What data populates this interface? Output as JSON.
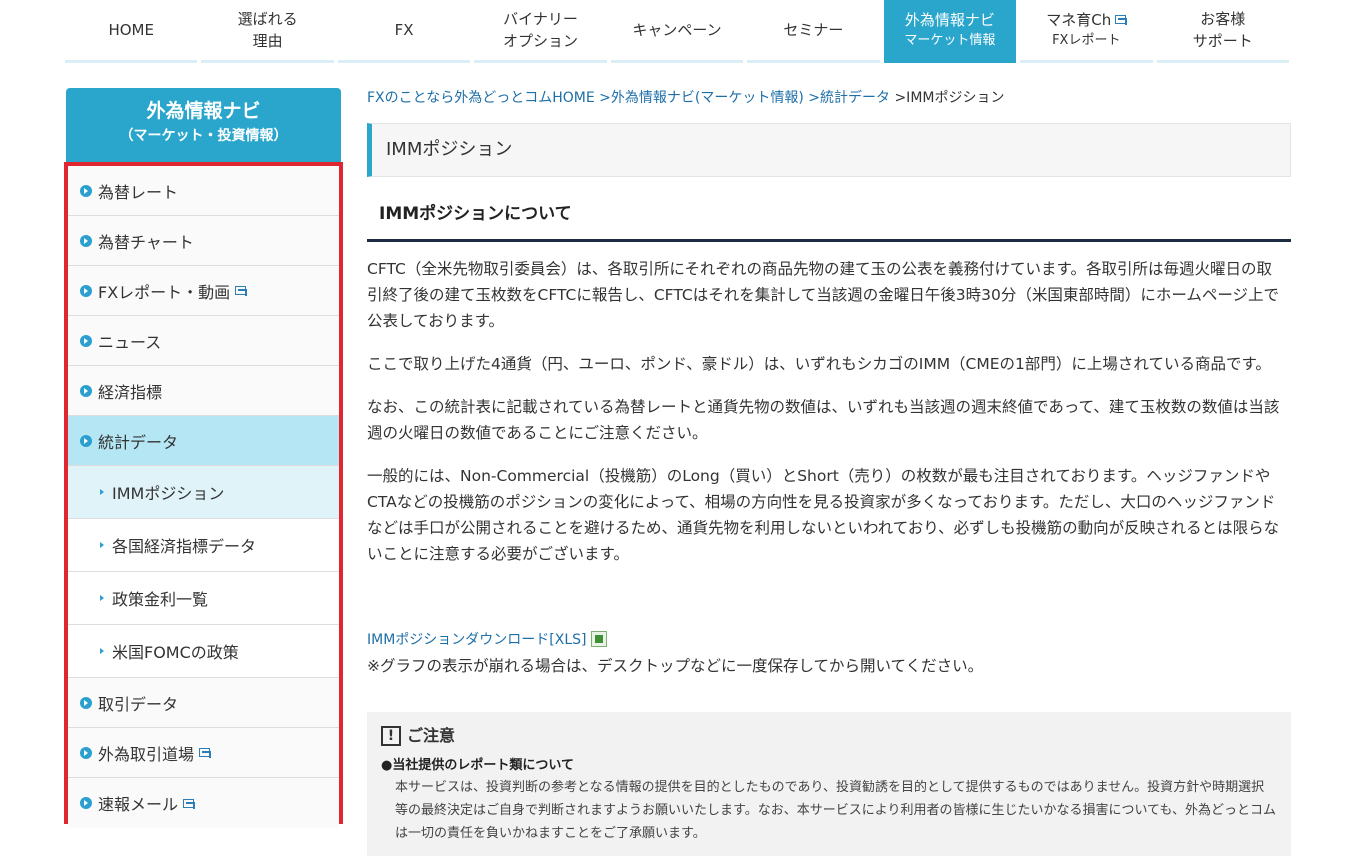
{
  "nav": {
    "items": [
      {
        "label": "HOME",
        "sub": ""
      },
      {
        "label": "選ばれる",
        "sub": "理由"
      },
      {
        "label": "FX",
        "sub": ""
      },
      {
        "label": "バイナリー",
        "sub": "オプション"
      },
      {
        "label": "キャンペーン",
        "sub": ""
      },
      {
        "label": "セミナー",
        "sub": ""
      },
      {
        "label": "外為情報ナビ",
        "sub": "マーケット情報"
      },
      {
        "label": "マネ育Ch",
        "sub": "FXレポート"
      },
      {
        "label": "お客様",
        "sub": "サポート"
      }
    ]
  },
  "sidebar": {
    "title": "外為情報ナビ",
    "subtitle": "（マーケット・投資情報）",
    "items": [
      "為替レート",
      "為替チャート",
      "FXレポート・動画",
      "ニュース",
      "経済指標",
      "統計データ",
      "IMMポジション",
      "各国経済指標データ",
      "政策金利一覧",
      "米国FOMCの政策",
      "取引データ",
      "外為取引道場",
      "速報メール"
    ]
  },
  "breadcrumb": {
    "home": "FXのことなら外為どっとコムHOME",
    "navi": ">外為情報ナビ(マーケット情報)",
    "stats": ">統計データ",
    "current": ">IMMポジション"
  },
  "page": {
    "title": "IMMポジション",
    "section_title": "IMMポジションについて",
    "paragraphs": [
      "CFTC（全米先物取引委員会）は、各取引所にそれぞれの商品先物の建て玉の公表を義務付けています。各取引所は毎週火曜日の取引終了後の建て玉枚数をCFTCに報告し、CFTCはそれを集計して当該週の金曜日午後3時30分（米国東部時間）にホームページ上で公表しております。",
      "ここで取り上げた4通貨（円、ユーロ、ポンド、豪ドル）は、いずれもシカゴのIMM（CMEの1部門）に上場されている商品です。",
      "なお、この統計表に記載されている為替レートと通貨先物の数値は、いずれも当該週の週末終値であって、建て玉枚数の数値は当該週の火曜日の数値であることにご注意ください。",
      "一般的には、Non-Commercial（投機筋）のLong（買い）とShort（売り）の枚数が最も注目されております。ヘッジファンドやCTAなどの投機筋のポジションの変化によって、相場の方向性を見る投資家が多くなっております。ただし、大口のヘッジファンドなどは手口が公開されることを避けるため、通貨先物を利用しないといわれており、必ずしも投機筋の動向が反映されるとは限らないことに注意する必要がございます。"
    ],
    "download_link": "IMMポジションダウンロード[XLS]",
    "download_note": "※グラフの表示が崩れる場合は、デスクトップなどに一度保存してから開いてください。"
  },
  "caution": {
    "icon": "!",
    "title": "ご注意",
    "subtitle": "●当社提供のレポート類について",
    "body": "本サービスは、投資判断の参考となる情報の提供を目的としたものであり、投資勧誘を目的として提供するものではありません。投資方針や時期選択等の最終決定はご自身で判断されますようお願いいたします。なお、本サービスにより利用者の皆様に生じたいかなる損害についても、外為どっとコムは一切の責任を負いかねますことをご了承願います。"
  }
}
